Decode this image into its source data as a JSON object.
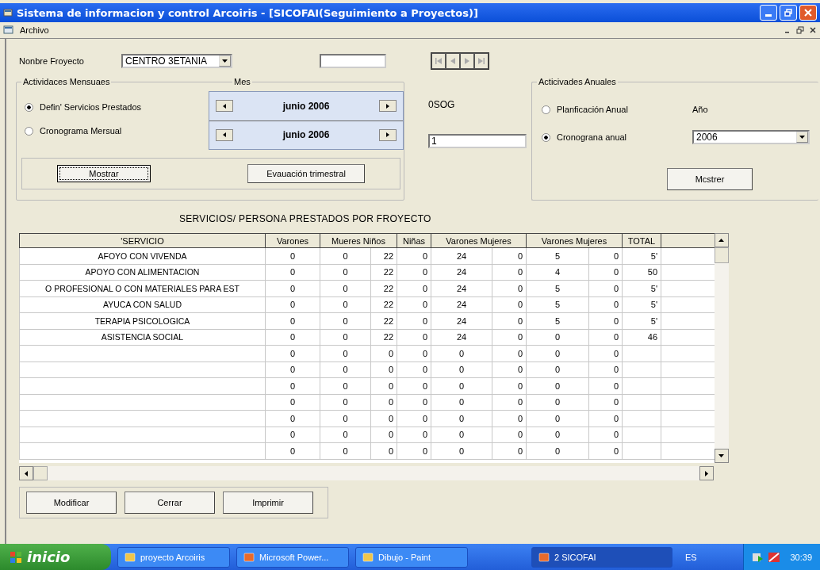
{
  "window": {
    "title": "Sistema de informacion y control Arcoiris - [SICOFAI(Seguimiento a Proyectos)]"
  },
  "menu": [
    "Archivo"
  ],
  "project": {
    "label": "Nonbre Froyecto",
    "value": "CENTRO 3ETANIA"
  },
  "monthly": {
    "legend": "Actividaces Mensuaes",
    "month_label": "Mes",
    "radios": [
      {
        "label": "Defin' Servicios Prestados",
        "selected": true
      },
      {
        "label": "Cronograma Mersual",
        "selected": false
      }
    ],
    "months": [
      "junio 2006",
      "junio 2006"
    ],
    "buttons": [
      {
        "label": "Mostrar",
        "focused": true
      },
      {
        "label": "Evauación trimestral",
        "focused": false
      }
    ]
  },
  "code": "0SOG",
  "code_field": {
    "value": "1"
  },
  "annual": {
    "legend": "Acticivades Anuales",
    "year_label": "Año",
    "year": "2006",
    "radios": [
      {
        "label": "Planficación Anual",
        "selected": false
      },
      {
        "label": "Cronograna anual",
        "selected": true
      }
    ],
    "button": "Mcstrer"
  },
  "table": {
    "title": "SERVICIOS/ PERSONA PRESTADOS POR FROYECTO",
    "columns": [
      "'SERVICIO",
      "Varones",
      "Mueres  Niños",
      "Niñas",
      "Varones  Mujeres",
      "Varones  Mujeres",
      "TOTAL"
    ],
    "rows": [
      {
        "service": "AFOYO CON VIVENDA",
        "values": [
          "0",
          "0",
          "22",
          "0",
          "24",
          "0",
          "5",
          "0"
        ],
        "total": "5'"
      },
      {
        "service": "APOYO CON ALIMENTACION",
        "values": [
          "0",
          "0",
          "22",
          "0",
          "24",
          "0",
          "4",
          "0"
        ],
        "total": "50"
      },
      {
        "service": "O PROFESIONAL O CON MATERIALES PARA EST",
        "values": [
          "0",
          "0",
          "22",
          "0",
          "24",
          "0",
          "5",
          "0"
        ],
        "total": "5'"
      },
      {
        "service": "AYUCA CON SALUD",
        "values": [
          "0",
          "0",
          "22",
          "0",
          "24",
          "0",
          "5",
          "0"
        ],
        "total": "5'"
      },
      {
        "service": "TERAPIA PSICOLOGICA",
        "values": [
          "0",
          "0",
          "22",
          "0",
          "24",
          "0",
          "5",
          "0"
        ],
        "total": "5'"
      },
      {
        "service": "ASISTENCIA SOCIAL",
        "values": [
          "0",
          "0",
          "22",
          "0",
          "24",
          "0",
          "0",
          "0"
        ],
        "total": "46"
      },
      {
        "values": [
          "0",
          "0",
          "0",
          "0",
          "0",
          "0",
          "0",
          "0"
        ]
      },
      {
        "values": [
          "0",
          "0",
          "0",
          "0",
          "0",
          "0",
          "0",
          "0"
        ]
      },
      {
        "values": [
          "0",
          "0",
          "0",
          "0",
          "0",
          "0",
          "0",
          "0"
        ]
      },
      {
        "values": [
          "0",
          "0",
          "0",
          "0",
          "0",
          "0",
          "0",
          "0"
        ]
      },
      {
        "values": [
          "0",
          "0",
          "0",
          "0",
          "0",
          "0",
          "0",
          "0"
        ]
      },
      {
        "values": [
          "0",
          "0",
          "0",
          "0",
          "0",
          "0",
          "0",
          "0"
        ]
      },
      {
        "values": [
          "0",
          "0",
          "0",
          "0",
          "0",
          "0",
          "0",
          "0"
        ]
      }
    ]
  },
  "actions": [
    "Modificar",
    "Cerrar",
    "Imprimir"
  ],
  "taskbar": {
    "start": "inicio",
    "tasks": [
      {
        "label": "proyecto Arcoiris",
        "selected": false
      },
      {
        "label": "Microsoft Power...",
        "selected": false
      },
      {
        "label": "Dibujo - Paint",
        "selected": false
      },
      {
        "label": "2 SICOFAI",
        "selected": true
      }
    ],
    "language": "ES",
    "clock": "30:39"
  }
}
